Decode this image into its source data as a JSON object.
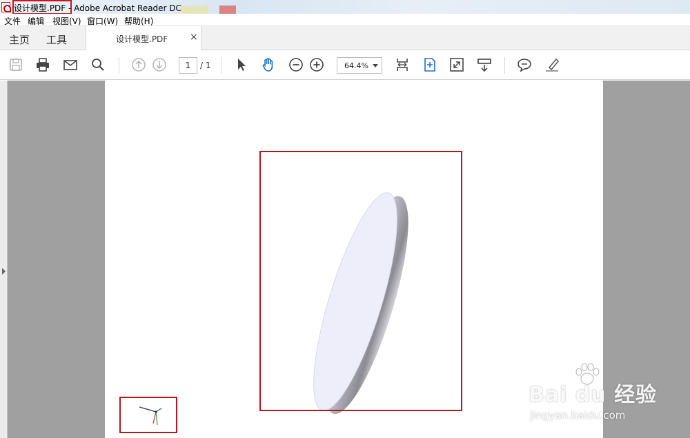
{
  "window": {
    "title": "设计模型.PDF - Adobe Acrobat Reader DC"
  },
  "menu": {
    "items": [
      "文件",
      "编辑",
      "视图(V)",
      "窗口(W)",
      "帮助(H)"
    ]
  },
  "tabs": {
    "home": "主页",
    "tools": "工具",
    "document": "设计模型.PDF",
    "close_symbol": "×"
  },
  "toolbar": {
    "icons": [
      "save-icon",
      "print-icon",
      "email-icon",
      "search-icon",
      "page-up-icon",
      "page-down-icon",
      "select-cursor-icon",
      "hand-tool-icon",
      "zoom-out-icon",
      "zoom-in-icon",
      "fit-width-icon",
      "fit-page-icon",
      "full-screen-icon",
      "scroll-mode-icon",
      "comment-icon",
      "highlight-icon"
    ],
    "page_current": "1",
    "page_total": "/ 1",
    "zoom": "64.4%"
  },
  "colors": {
    "annotation_box": "#b4181d",
    "hand_tool_active": "#1d6fc4",
    "disc_face": "#eeedfa"
  },
  "watermark": {
    "main": "Bai du 经验",
    "sub": "jingyan.baidu.com"
  }
}
